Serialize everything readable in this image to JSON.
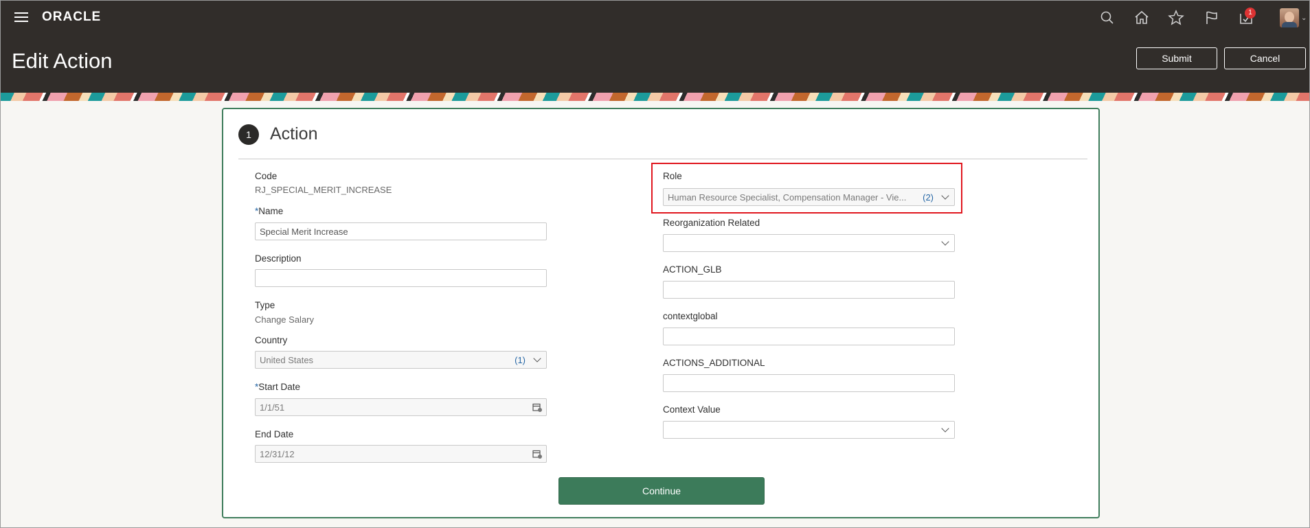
{
  "header": {
    "logo": "ORACLE",
    "page_title": "Edit Action",
    "notification_count": "1",
    "submit_label": "Submit",
    "cancel_label": "Cancel",
    "icons": [
      "menu-icon",
      "search-icon",
      "home-icon",
      "star-icon",
      "flag-icon",
      "notifications-icon",
      "user-avatar"
    ]
  },
  "section": {
    "step_number": "1",
    "title": "Action"
  },
  "form": {
    "code_label": "Code",
    "code_value": "RJ_SPECIAL_MERIT_INCREASE",
    "name_label": "Name",
    "name_value": "Special Merit Increase",
    "description_label": "Description",
    "description_value": "",
    "type_label": "Type",
    "type_value": "Change Salary",
    "country_label": "Country",
    "country_value": "United States",
    "country_count": "(1)",
    "start_date_label": "Start Date",
    "start_date_value": "1/1/51",
    "end_date_label": "End Date",
    "end_date_value": "12/31/12",
    "role_label": "Role",
    "role_value": "Human Resource Specialist, Compensation Manager - Vie...",
    "role_count": "(2)",
    "reorg_label": "Reorganization Related",
    "reorg_value": "",
    "action_glb_label": "ACTION_GLB",
    "action_glb_value": "",
    "contextglobal_label": "contextglobal",
    "contextglobal_value": "",
    "actions_additional_label": "ACTIONS_ADDITIONAL",
    "actions_additional_value": "",
    "context_value_label": "Context Value",
    "context_value_value": "",
    "required_marker": "*"
  },
  "continue_label": "Continue",
  "colors": {
    "header_bg": "#312d2a",
    "primary_button": "#3c7b5a",
    "link_blue": "#2566a5",
    "highlight_red": "#e0161e"
  }
}
